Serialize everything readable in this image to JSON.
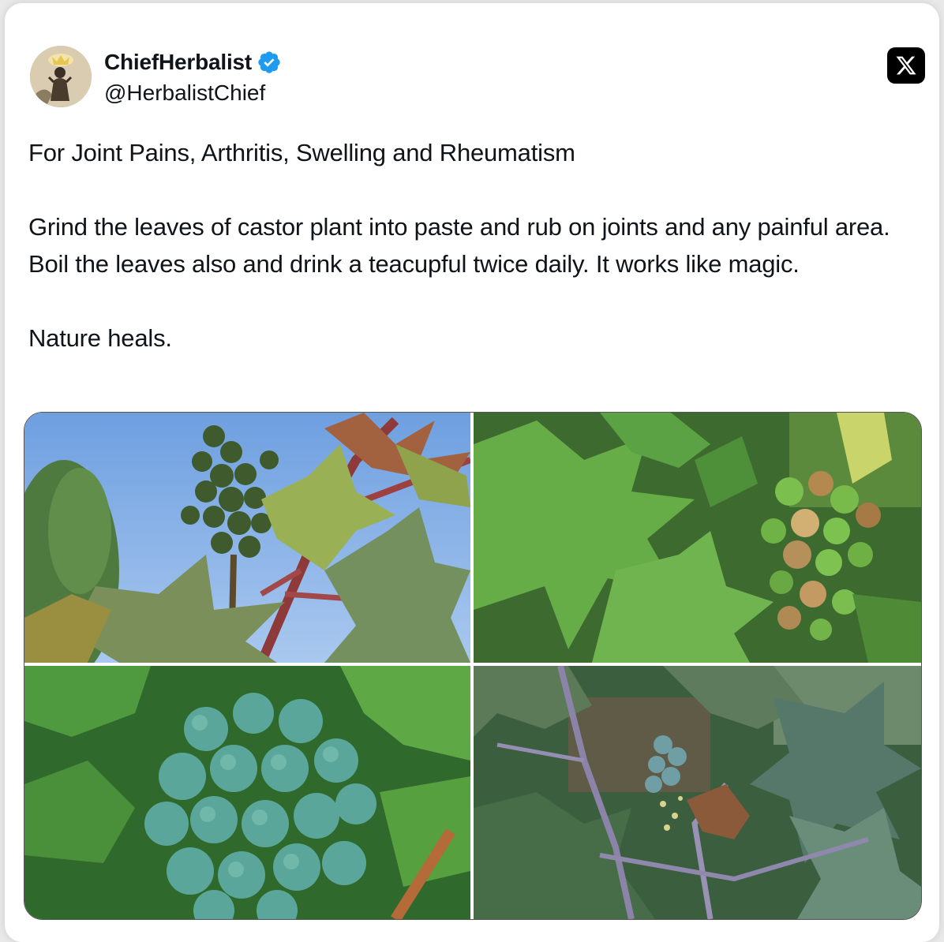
{
  "author": {
    "display_name": "ChiefHerbalist",
    "handle": "@HerbalistChief",
    "verified": true,
    "avatar_icon": "avatar-image"
  },
  "platform_icon": "x-logo-icon",
  "post": {
    "paragraphs": [
      "For Joint Pains, Arthritis, Swelling and Rheumatism",
      "Grind the leaves of castor plant into paste and rub on joints and any painful area. Boil the leaves also and drink a teacupful twice daily. It works like magic.",
      "Nature heals."
    ]
  },
  "media": {
    "photos": [
      {
        "icon": "castor-plant-blue-sky-photo"
      },
      {
        "icon": "castor-seed-pods-photo"
      },
      {
        "icon": "castor-spiky-fruits-photo"
      },
      {
        "icon": "castor-plant-purple-stems-photo"
      }
    ]
  },
  "colors": {
    "verified_blue": "#1d9bf0",
    "text": "#0f1419",
    "x_logo_bg": "#000000"
  }
}
